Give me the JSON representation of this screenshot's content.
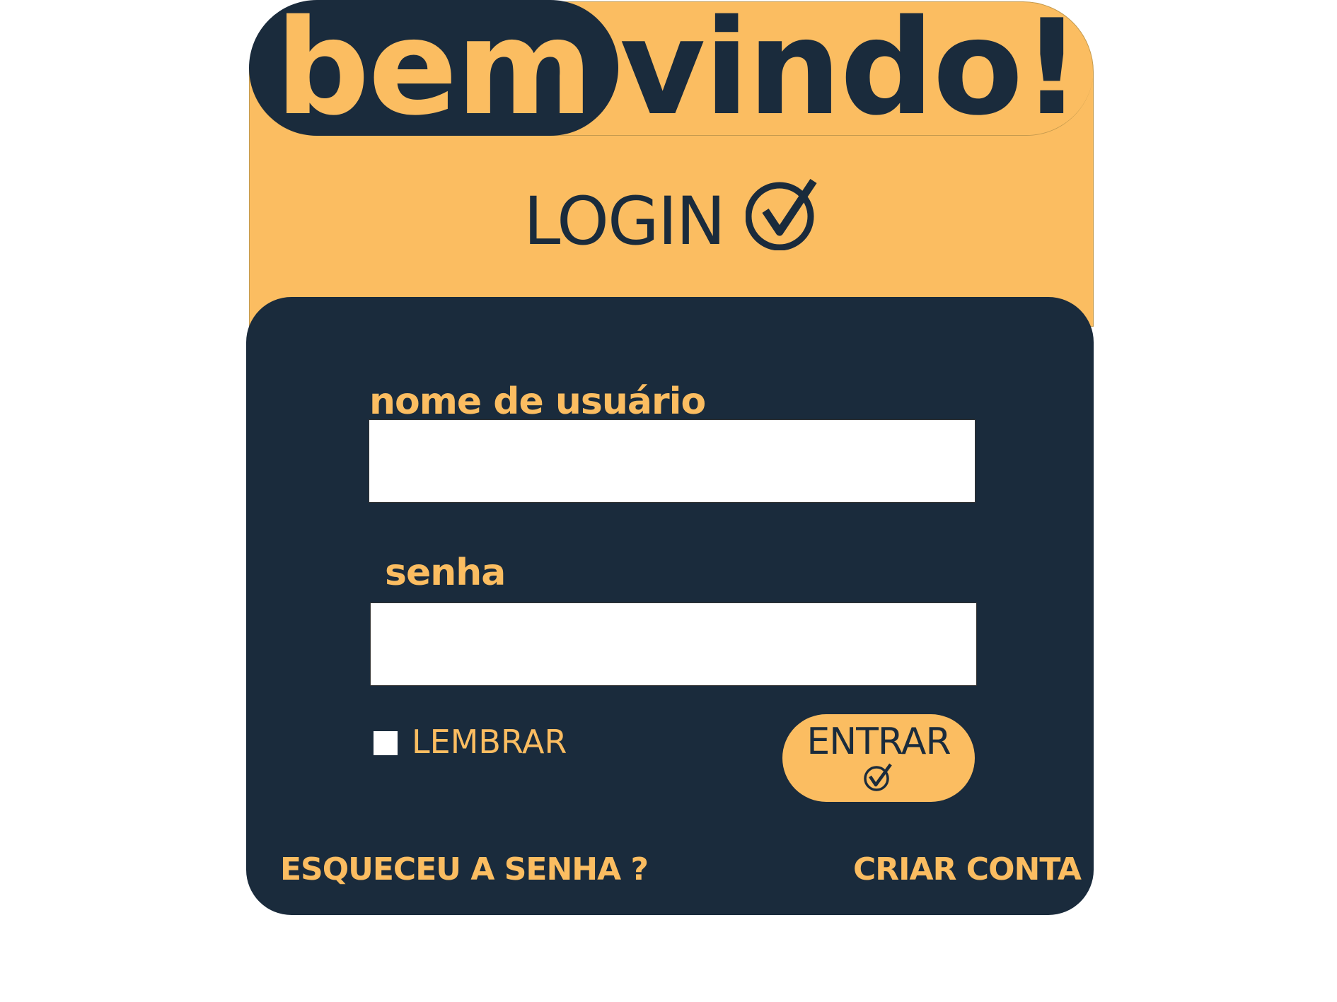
{
  "header": {
    "welcome_part1": "bem",
    "welcome_part2": "vindo!"
  },
  "login": {
    "title": "LOGIN",
    "title_icon": "check-circle-icon"
  },
  "form": {
    "username_label": "nome de usuário",
    "username_value": "",
    "password_label": "senha",
    "password_value": "",
    "remember_label": "LEMBRAR",
    "remember_checked": false,
    "enter_label": "ENTRAR",
    "enter_icon": "check-circle-icon"
  },
  "links": {
    "forgot_password": "ESQUECEU A SENHA ?",
    "create_account": "CRIAR CONTA"
  },
  "colors": {
    "accent": "#fbbd61",
    "dark": "#1a2b3c",
    "input_background": "#ffffff"
  }
}
